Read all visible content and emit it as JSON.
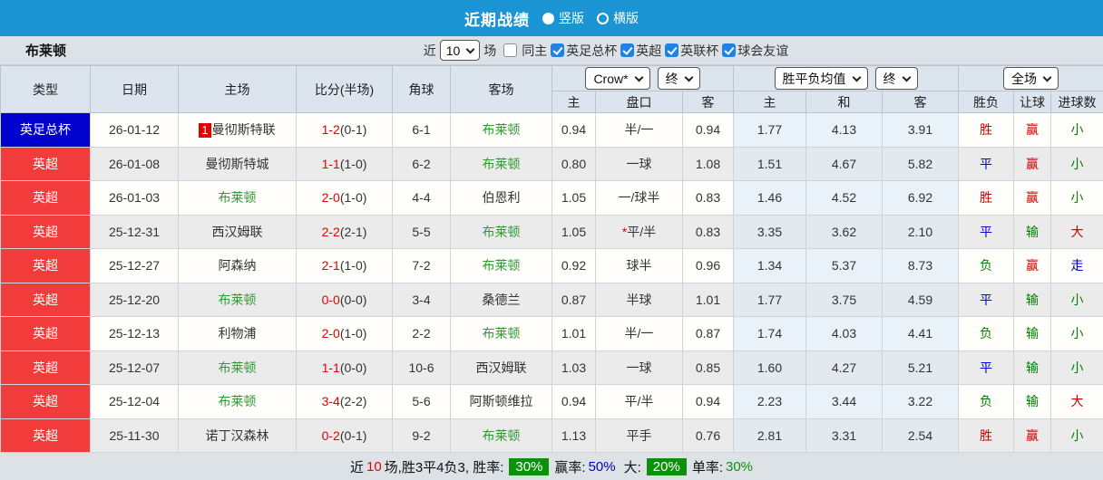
{
  "title_bar": {
    "title": "近期战绩",
    "layout_options": [
      {
        "label": "竖版",
        "selected": true
      },
      {
        "label": "横版",
        "selected": false
      }
    ]
  },
  "filter_bar": {
    "team_name": "布莱顿",
    "near_label": "近",
    "match_count": "10",
    "games_label": "场",
    "same_home": {
      "label": "同主",
      "checked": false
    },
    "competitions": [
      {
        "label": "英足总杯",
        "checked": true
      },
      {
        "label": "英超",
        "checked": true
      },
      {
        "label": "英联杯",
        "checked": true
      },
      {
        "label": "球会友谊",
        "checked": true
      }
    ]
  },
  "table": {
    "columns": {
      "type": "类型",
      "date": "日期",
      "home": "主场",
      "score": "比分(半场)",
      "corner": "角球",
      "away": "客场",
      "odds_home": "主",
      "odds_handicap": "盘口",
      "odds_away": "客",
      "mean_home": "主",
      "mean_draw": "和",
      "mean_away": "客",
      "result": "胜负",
      "handicap_result": "让球",
      "goals": "进球数"
    },
    "selects": {
      "company": "Crow*",
      "company_time": "终",
      "mean": "胜平负均值",
      "mean_time": "终",
      "scope": "全场"
    },
    "rows": [
      {
        "type": "英足总杯",
        "type_class": "t-blue",
        "date": "26-01-12",
        "home_badge": "1",
        "home": "曼彻斯特联",
        "home_class": "",
        "score": "1-2",
        "half": "(0-1)",
        "corner": "6-1",
        "away": "布莱顿",
        "away_class": "team-green",
        "odds_home": "0.94",
        "handicap_star": "",
        "handicap": "半/一",
        "odds_away": "0.94",
        "mean_home": "1.77",
        "mean_draw": "4.13",
        "mean_away": "3.91",
        "result": "胜",
        "result_class": "c-red",
        "handicap_result": "赢",
        "handicap_result_class": "c-red",
        "goals": "小",
        "goals_class": "c-green"
      },
      {
        "type": "英超",
        "type_class": "t-red",
        "date": "26-01-08",
        "home_badge": "",
        "home": "曼彻斯特城",
        "home_class": "",
        "score": "1-1",
        "half": "(1-0)",
        "corner": "6-2",
        "away": "布莱顿",
        "away_class": "team-green",
        "odds_home": "0.80",
        "handicap_star": "",
        "handicap": "一球",
        "odds_away": "1.08",
        "mean_home": "1.51",
        "mean_draw": "4.67",
        "mean_away": "5.82",
        "result": "平",
        "result_class": "c-blue",
        "handicap_result": "赢",
        "handicap_result_class": "c-red",
        "goals": "小",
        "goals_class": "c-green"
      },
      {
        "type": "英超",
        "type_class": "t-red",
        "date": "26-01-03",
        "home_badge": "",
        "home": "布莱顿",
        "home_class": "team-green",
        "score": "2-0",
        "half": "(1-0)",
        "corner": "4-4",
        "away": "伯恩利",
        "away_class": "",
        "odds_home": "1.05",
        "handicap_star": "",
        "handicap": "一/球半",
        "odds_away": "0.83",
        "mean_home": "1.46",
        "mean_draw": "4.52",
        "mean_away": "6.92",
        "result": "胜",
        "result_class": "c-red",
        "handicap_result": "赢",
        "handicap_result_class": "c-red",
        "goals": "小",
        "goals_class": "c-green"
      },
      {
        "type": "英超",
        "type_class": "t-red",
        "date": "25-12-31",
        "home_badge": "",
        "home": "西汉姆联",
        "home_class": "",
        "score": "2-2",
        "half": "(2-1)",
        "corner": "5-5",
        "away": "布莱顿",
        "away_class": "team-green",
        "odds_home": "1.05",
        "handicap_star": "*",
        "handicap": "平/半",
        "odds_away": "0.83",
        "mean_home": "3.35",
        "mean_draw": "3.62",
        "mean_away": "2.10",
        "result": "平",
        "result_class": "c-blue",
        "handicap_result": "输",
        "handicap_result_class": "c-green",
        "goals": "大",
        "goals_class": "c-red"
      },
      {
        "type": "英超",
        "type_class": "t-red",
        "date": "25-12-27",
        "home_badge": "",
        "home": "阿森纳",
        "home_class": "",
        "score": "2-1",
        "half": "(1-0)",
        "corner": "7-2",
        "away": "布莱顿",
        "away_class": "team-green",
        "odds_home": "0.92",
        "handicap_star": "",
        "handicap": "球半",
        "odds_away": "0.96",
        "mean_home": "1.34",
        "mean_draw": "5.37",
        "mean_away": "8.73",
        "result": "负",
        "result_class": "c-green",
        "handicap_result": "赢",
        "handicap_result_class": "c-red",
        "goals": "走",
        "goals_class": "c-blue"
      },
      {
        "type": "英超",
        "type_class": "t-red",
        "date": "25-12-20",
        "home_badge": "",
        "home": "布莱顿",
        "home_class": "team-green",
        "score": "0-0",
        "half": "(0-0)",
        "corner": "3-4",
        "away": "桑德兰",
        "away_class": "",
        "odds_home": "0.87",
        "handicap_star": "",
        "handicap": "半球",
        "odds_away": "1.01",
        "mean_home": "1.77",
        "mean_draw": "3.75",
        "mean_away": "4.59",
        "result": "平",
        "result_class": "c-blue",
        "handicap_result": "输",
        "handicap_result_class": "c-green",
        "goals": "小",
        "goals_class": "c-green"
      },
      {
        "type": "英超",
        "type_class": "t-red",
        "date": "25-12-13",
        "home_badge": "",
        "home": "利物浦",
        "home_class": "",
        "score": "2-0",
        "half": "(1-0)",
        "corner": "2-2",
        "away": "布莱顿",
        "away_class": "team-green",
        "odds_home": "1.01",
        "handicap_star": "",
        "handicap": "半/一",
        "odds_away": "0.87",
        "mean_home": "1.74",
        "mean_draw": "4.03",
        "mean_away": "4.41",
        "result": "负",
        "result_class": "c-green",
        "handicap_result": "输",
        "handicap_result_class": "c-green",
        "goals": "小",
        "goals_class": "c-green"
      },
      {
        "type": "英超",
        "type_class": "t-red",
        "date": "25-12-07",
        "home_badge": "",
        "home": "布莱顿",
        "home_class": "team-green",
        "score": "1-1",
        "half": "(0-0)",
        "corner": "10-6",
        "away": "西汉姆联",
        "away_class": "",
        "odds_home": "1.03",
        "handicap_star": "",
        "handicap": "一球",
        "odds_away": "0.85",
        "mean_home": "1.60",
        "mean_draw": "4.27",
        "mean_away": "5.21",
        "result": "平",
        "result_class": "c-blue",
        "handicap_result": "输",
        "handicap_result_class": "c-green",
        "goals": "小",
        "goals_class": "c-green"
      },
      {
        "type": "英超",
        "type_class": "t-red",
        "date": "25-12-04",
        "home_badge": "",
        "home": "布莱顿",
        "home_class": "team-green",
        "score": "3-4",
        "half": "(2-2)",
        "corner": "5-6",
        "away": "阿斯顿维拉",
        "away_class": "",
        "odds_home": "0.94",
        "handicap_star": "",
        "handicap": "平/半",
        "odds_away": "0.94",
        "mean_home": "2.23",
        "mean_draw": "3.44",
        "mean_away": "3.22",
        "result": "负",
        "result_class": "c-green",
        "handicap_result": "输",
        "handicap_result_class": "c-green",
        "goals": "大",
        "goals_class": "c-red"
      },
      {
        "type": "英超",
        "type_class": "t-red",
        "date": "25-11-30",
        "home_badge": "",
        "home": "诺丁汉森林",
        "home_class": "",
        "score": "0-2",
        "half": "(0-1)",
        "corner": "9-2",
        "away": "布莱顿",
        "away_class": "team-green",
        "odds_home": "1.13",
        "handicap_star": "",
        "handicap": "平手",
        "odds_away": "0.76",
        "mean_home": "2.81",
        "mean_draw": "3.31",
        "mean_away": "2.54",
        "result": "胜",
        "result_class": "c-red",
        "handicap_result": "赢",
        "handicap_result_class": "c-red",
        "goals": "小",
        "goals_class": "c-green"
      }
    ]
  },
  "footer": {
    "prefix": "近",
    "count": "10",
    "summary": "场,胜3平4负3, 胜率:",
    "win_rate": "30%",
    "win_odds_label": "赢率:",
    "win_odds": "50%",
    "big_label": "大:",
    "big_rate": "20%",
    "single_label": "单率:",
    "single_rate": "30%"
  }
}
